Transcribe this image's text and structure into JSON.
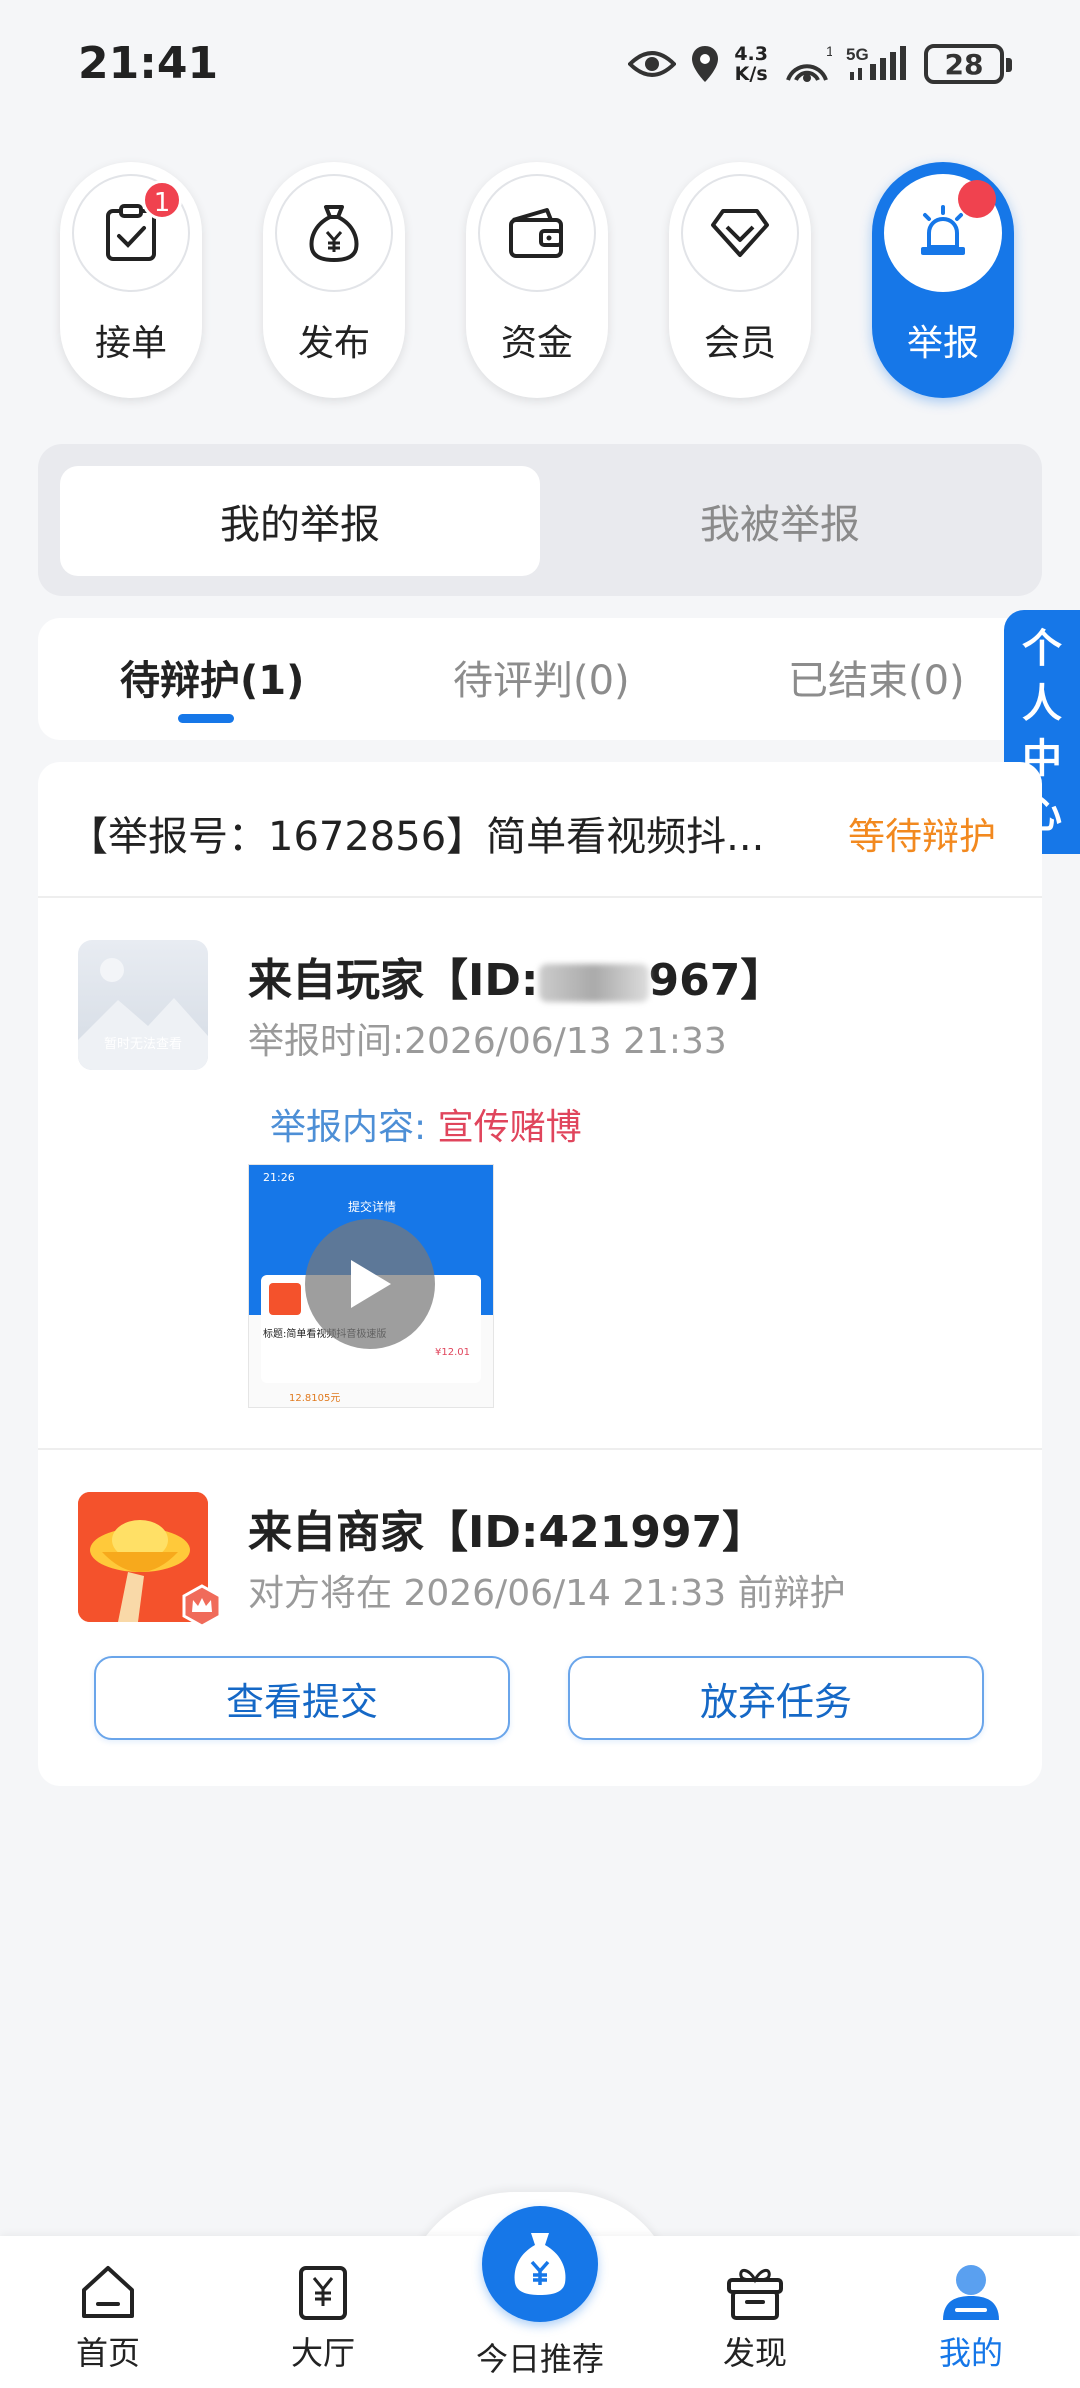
{
  "status_bar": {
    "time": "21:41",
    "net_speed_value": "4.3",
    "net_speed_unit": "K/s",
    "hotspot_count": "1",
    "network": "5G",
    "battery": "28"
  },
  "quick_menu": [
    {
      "label": "接单",
      "icon": "task-check-icon",
      "badge": "1"
    },
    {
      "label": "发布",
      "icon": "money-bag-icon"
    },
    {
      "label": "资金",
      "icon": "wallet-icon"
    },
    {
      "label": "会员",
      "icon": "diamond-icon"
    },
    {
      "label": "举报",
      "icon": "alarm-light-icon",
      "active": true
    }
  ],
  "segment_tabs": {
    "mine": "我的举报",
    "reported": "我被举报",
    "active": "mine"
  },
  "status_tabs": [
    {
      "label": "待辩护(1)",
      "active": true
    },
    {
      "label": "待评判(0)"
    },
    {
      "label": "已结束(0)"
    }
  ],
  "side_float": {
    "label": "个人中心"
  },
  "report": {
    "title": "【举报号：1672856】简单看视频抖...",
    "status": "等待辩护",
    "player": {
      "name_prefix": "来自玩家【ID:",
      "name_suffix": "967】",
      "time": "举报时间:2026/06/13 21:33",
      "content_label": "举报内容:",
      "content_value": "宣传赌博",
      "avatar_text": "暂时无法查看"
    },
    "merchant": {
      "name": "来自商家【ID:421997】",
      "deadline": "对方将在 2026/06/14 21:33 前辩护"
    },
    "actions": {
      "view": "查看提交",
      "abandon": "放弃任务"
    }
  },
  "thumbnail": {
    "time": "21:26",
    "title": "提交详情",
    "task": "标题:简单看视频抖音极速版",
    "price": "¥12.01",
    "member_price": "12.8105元"
  },
  "bottom_nav": [
    {
      "label": "首页",
      "icon": "home-icon"
    },
    {
      "label": "大厅",
      "icon": "hall-icon"
    },
    {
      "label": "今日推荐",
      "icon": "money-bag-icon",
      "center": true
    },
    {
      "label": "发现",
      "icon": "gift-box-icon"
    },
    {
      "label": "我的",
      "icon": "user-icon",
      "active": true
    }
  ],
  "colors": {
    "primary": "#1677e8",
    "warning": "#f2891f",
    "danger": "#e0455c",
    "badge": "#f0424f"
  }
}
